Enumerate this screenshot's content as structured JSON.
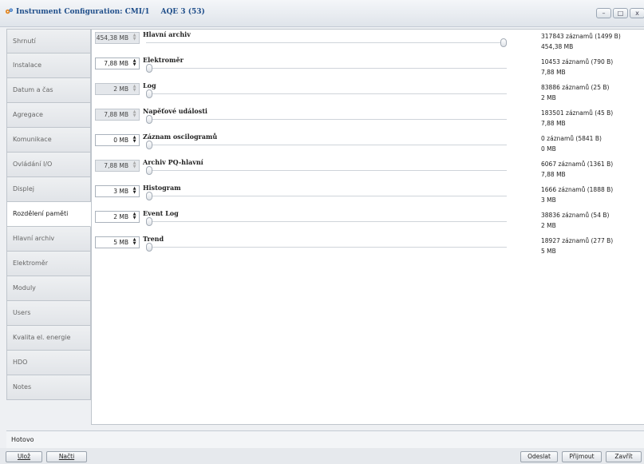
{
  "window": {
    "title": "Instrument Configuration: CMI/1",
    "subtitle": "AQE 3 (53)",
    "minimize_glyph": "–",
    "maximize_glyph": "□",
    "close_glyph": "x"
  },
  "sidebar": {
    "items": [
      {
        "label": "Shrnutí"
      },
      {
        "label": "Instalace"
      },
      {
        "label": "Datum a čas"
      },
      {
        "label": "Agregace"
      },
      {
        "label": "Komunikace"
      },
      {
        "label": "Ovládání I/O"
      },
      {
        "label": "Displej"
      },
      {
        "label": "Rozdělení paměti"
      },
      {
        "label": "Hlavní archiv"
      },
      {
        "label": "Elektroměr"
      },
      {
        "label": "Moduly"
      },
      {
        "label": "Users"
      },
      {
        "label": "Kvalita el. energie"
      },
      {
        "label": "HDO"
      },
      {
        "label": "Notes"
      }
    ],
    "active_index": 7
  },
  "memory": {
    "rows": [
      {
        "label": "Hlavní archiv",
        "value": "454,38 MB",
        "disabled": true,
        "level": 1.0,
        "count": "317843 záznamů (1499 B)",
        "size": "454,38 MB"
      },
      {
        "label": "Elektroměr",
        "value": "7,88 MB",
        "disabled": false,
        "level": 0.0,
        "count": "10453 záznamů (790 B)",
        "size": "7,88 MB"
      },
      {
        "label": "Log",
        "value": "2 MB",
        "disabled": true,
        "level": 0.0,
        "count": "83886 záznamů (25 B)",
        "size": "2 MB"
      },
      {
        "label": "Napěťové události",
        "value": "7,88 MB",
        "disabled": true,
        "level": 0.0,
        "count": "183501 záznamů (45 B)",
        "size": "7,88 MB"
      },
      {
        "label": "Záznam oscilogramů",
        "value": "0 MB",
        "disabled": false,
        "level": 0.0,
        "count": "0 záznamů (5841 B)",
        "size": "0 MB"
      },
      {
        "label": "Archiv PQ-hlavní",
        "value": "7,88 MB",
        "disabled": true,
        "level": 0.0,
        "count": "6067 záznamů (1361 B)",
        "size": "7,88 MB"
      },
      {
        "label": "Histogram",
        "value": "3 MB",
        "disabled": false,
        "level": 0.0,
        "count": "1666 záznamů (1888 B)",
        "size": "3 MB"
      },
      {
        "label": "Event Log",
        "value": "2 MB",
        "disabled": false,
        "level": 0.0,
        "count": "38836 záznamů (54 B)",
        "size": "2 MB"
      },
      {
        "label": "Trend",
        "value": "5 MB",
        "disabled": false,
        "level": 0.0,
        "count": "18927 záznamů (277 B)",
        "size": "5 MB"
      }
    ]
  },
  "status": {
    "text": "Hotovo"
  },
  "buttons": {
    "save": "Ulož",
    "load": "Načti",
    "send": "Odeslat",
    "receive": "Přijmout",
    "close": "Zavřít"
  },
  "colors": {
    "title": "#1f4e8a",
    "active_tab": "#ffffff",
    "panel": "#ffffff"
  }
}
